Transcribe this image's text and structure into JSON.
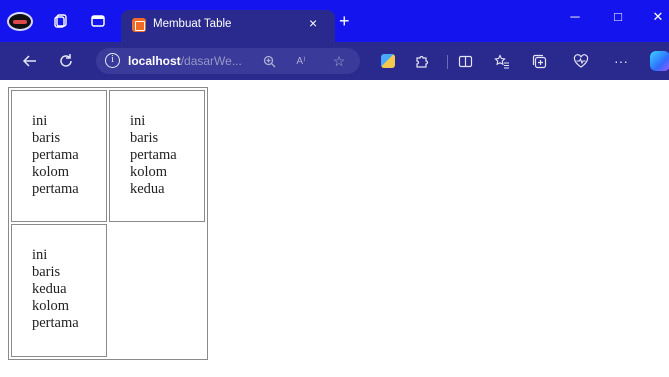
{
  "browser": {
    "tab_title": "Membuat Table",
    "tab_close": "×",
    "new_tab": "+",
    "window_controls": {
      "minimize": "─",
      "maximize": "□",
      "close": "✕"
    },
    "address": {
      "host": "localhost",
      "path": "/dasarWe...",
      "zoom_icon": "zoom-in-icon",
      "read_aloud_label": "A⁾",
      "favorite_icon": "star-icon"
    },
    "toolbar_more": "···"
  },
  "page": {
    "table": {
      "rows": [
        [
          {
            "words": [
              "ini",
              "baris",
              "pertama",
              "kolom",
              "pertama"
            ]
          },
          {
            "words": [
              "ini",
              "baris",
              "pertama",
              "kolom",
              "kedua"
            ]
          }
        ],
        [
          {
            "words": [
              "ini",
              "baris",
              "kedua",
              "kolom",
              "pertama"
            ]
          }
        ]
      ]
    }
  },
  "colors": {
    "titlebar": "#1414ee",
    "toolbar": "#2a2a8e",
    "tab_active": "#2a2a8e"
  }
}
